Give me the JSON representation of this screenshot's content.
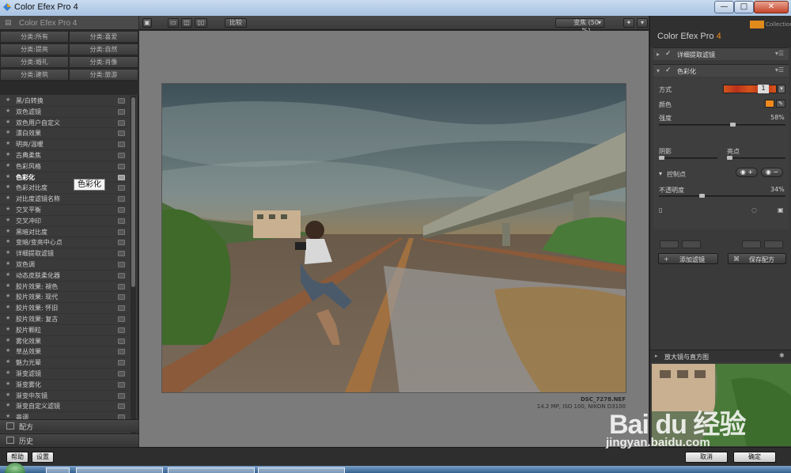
{
  "window": {
    "title": "Color Efex Pro 4",
    "minimize": "—",
    "maximize": "□",
    "close": "✕"
  },
  "left_panel": {
    "header_title": "Color Efex Pro 4",
    "categories": [
      "分类:所有",
      "分类:喜爱",
      "分类:提亮",
      "分类:自然",
      "分类:婚礼",
      "分类:肖像",
      "分类:建筑",
      "分类:旅游"
    ],
    "filters": [
      "黑/白转换",
      "双色滤镜",
      "双色用户自定义",
      "漂白效果",
      "明亮/温暖",
      "古典柔焦",
      "色彩风格",
      "色彩化",
      "色彩对比度",
      "对比度滤镜名称",
      "交叉平衡",
      "交叉冲印",
      "黑暗对比度",
      "变暗/变亮中心点",
      "详细提取滤镜",
      "双色调",
      "动态皮肤柔化器",
      "胶片效果: 褪色",
      "胶片效果: 现代",
      "胶片效果: 怀旧",
      "胶片效果: 复古",
      "胶片颗粒",
      "雾化效果",
      "草丛效果",
      "魅力光晕",
      "渐变滤镜",
      "渐变雾化",
      "渐变中灰镜",
      "渐变自定义滤镜",
      "高调",
      "图像边框"
    ],
    "active_filter": "色彩化",
    "tooltip": "色彩化",
    "tab_recipe": "配方",
    "tab_history": "历史"
  },
  "toolbar": {
    "compare_label": "比较",
    "zoom_label": "变焦 (50 %)",
    "zoom_caret": "▾"
  },
  "canvas": {
    "file_name": "DSC_7278.NEF",
    "file_meta": "14.2 MP, ISO 100, NIKON D3100"
  },
  "right_panel": {
    "app_name": "Color Efex Pro",
    "app_version": "4",
    "collection_label": "Collection",
    "filter_stack": [
      {
        "name": "详细提取滤镜",
        "enabled": true,
        "expanded": false
      },
      {
        "name": "色彩化",
        "enabled": true,
        "expanded": true
      }
    ],
    "settings": {
      "method_label": "方式",
      "method_value": "1",
      "color_label": "颜色",
      "color_value": "#f08a1c",
      "strength_label": "强度",
      "strength_value": "58%",
      "strength_fraction": 0.58,
      "shadows_label": "阴影",
      "highlights_label": "亮点",
      "control_points_label": "控制点",
      "opacity_label": "不透明度",
      "opacity_value": "34%",
      "opacity_fraction": 0.34
    },
    "add_filter_label": "添加滤镜",
    "save_recipe_label": "保存配方",
    "loupe_label": "放大镜与直方图"
  },
  "bottom_bar": {
    "help_label": "帮助",
    "settings_label": "设置",
    "cancel_label": "取消",
    "ok_label": "确定"
  },
  "watermark": {
    "text": "Bai du 经验",
    "url": "jingyan.baidu.com"
  }
}
